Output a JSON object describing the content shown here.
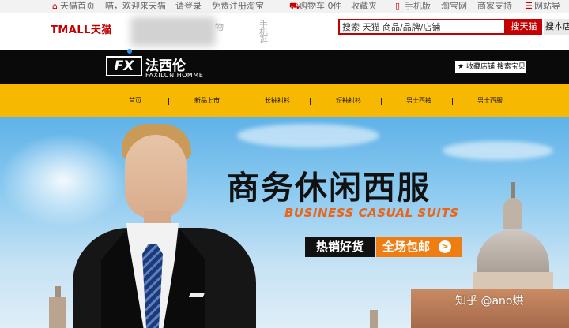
{
  "topbar": {
    "items": [
      {
        "icon": "home-icon",
        "label": "天猫首页"
      },
      {
        "label": "喵，欢迎来天猫"
      },
      {
        "label": "请登录"
      },
      {
        "label": "免费注册"
      },
      {
        "label": "淘宝"
      },
      {
        "icon": "cart-icon",
        "label": "购物车 0件"
      },
      {
        "label": "收藏夹"
      },
      {
        "icon": "phone-icon",
        "label": "手机版"
      },
      {
        "label": "淘宝网"
      },
      {
        "label": "商家支持"
      },
      {
        "icon": "menu-icon",
        "label": "网站导"
      }
    ]
  },
  "header": {
    "logo": "TMALL天猫",
    "faded_text": "物",
    "faded_text2": "手机逛",
    "search_placeholder": "搜索 天猫 商品/品牌/店铺",
    "search_button": "搜天猫",
    "search_button2": "搜本店"
  },
  "brand": {
    "mark": "FX",
    "name_cn": "法西伦",
    "name_en": "FAXILUN HOMME",
    "fav_label": "收藏店铺 搜索宝贝店"
  },
  "nav": {
    "items": [
      "首页",
      "新品上市",
      "长袖衬衫",
      "短袖衬衫",
      "男士西裤",
      "男士西服"
    ]
  },
  "banner": {
    "headline": "商务休闲西服",
    "subline": "BUSINESS CASUAL SUITS",
    "tag_hot": "热销好货",
    "tag_ship": "全场包邮",
    "tag_arrow": ">",
    "watermark": "知乎 @ano烘"
  },
  "colors": {
    "tmall_red": "#c40000",
    "nav_yellow": "#f6b800",
    "accent_orange": "#f07d12"
  }
}
